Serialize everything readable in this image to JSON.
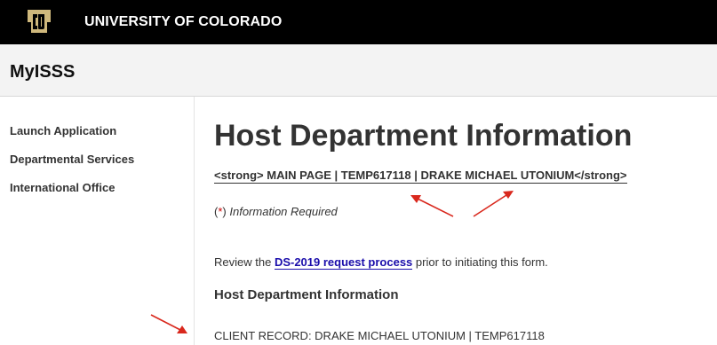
{
  "header": {
    "university": "UNIVERSITY OF COLORADO",
    "bg_color": "#000000"
  },
  "app": {
    "name": "MyISSS"
  },
  "sidebar": {
    "items": [
      {
        "label": "Launch Application"
      },
      {
        "label": "Departmental Services"
      },
      {
        "label": "International Office"
      }
    ]
  },
  "main": {
    "title": "Host Department Information",
    "breadcrumb": "<strong> MAIN PAGE | TEMP617118 | DRAKE MICHAEL UTONIUM</strong>",
    "required": {
      "open_paren": "(",
      "star": "*",
      "close_paren": ")",
      "note": "Information Required"
    },
    "review": {
      "prefix": "Review the",
      "link": "DS-2019 request process",
      "suffix": "prior to initiating this form."
    },
    "section_title": "Host Department Information",
    "client_record": "CLIENT RECORD: DRAKE MICHAEL UTONIUM | TEMP617118"
  },
  "annotation": {
    "arrow_color": "#d9281d"
  },
  "icons": {
    "logo": "cu-logo-icon"
  }
}
